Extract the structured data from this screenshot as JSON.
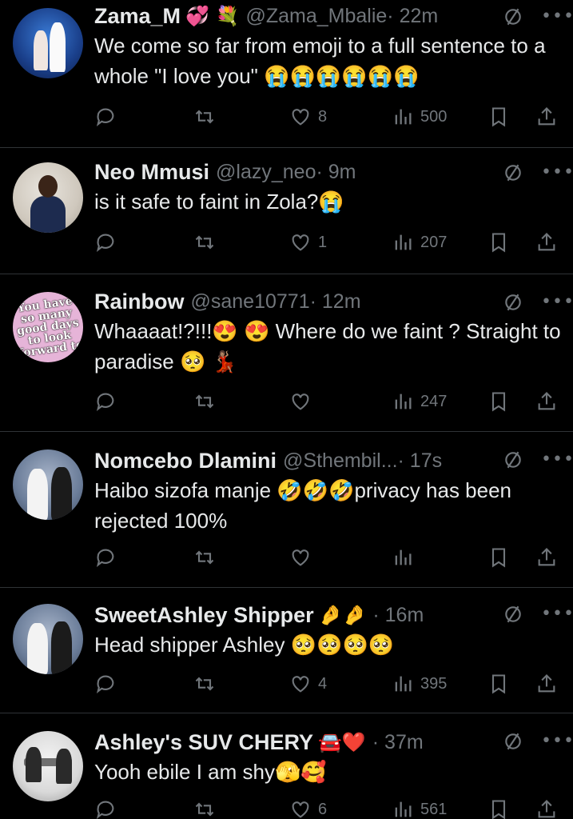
{
  "tweets": [
    {
      "name": "Zama_M",
      "name_emoji": "💞 💐",
      "handle": "@Zama_Mbalie",
      "time": "· 22m",
      "text": "We come so far from emoji to a full sentence to a whole \"I love you\" 😭😭😭😭😭😭",
      "likes": "8",
      "views": "500",
      "retweets": "",
      "replies": ""
    },
    {
      "name": "Neo Mmusi",
      "name_emoji": "",
      "handle": "@lazy_neo",
      "time": "· 9m",
      "text": "is it safe to faint in Zola?😭",
      "likes": "1",
      "views": "207",
      "retweets": "",
      "replies": ""
    },
    {
      "name": "Rainbow",
      "name_emoji": "",
      "handle": "@sane10771",
      "time": "· 12m",
      "text": "Whaaaat!?!!!😍 😍 Where do we faint ? Straight to paradise 🥺 💃🏽",
      "likes": "",
      "views": "247",
      "retweets": "",
      "replies": "",
      "avatar_text": [
        "You have",
        "so many",
        "good days",
        "to look",
        "forward to"
      ]
    },
    {
      "name": "Nomcebo Dlamini",
      "name_emoji": "",
      "handle": "@Sthembil...",
      "time": "· 17s",
      "text": "Haibo sizofa manje 🤣🤣🤣privacy has been rejected 100%",
      "likes": "",
      "views": "",
      "retweets": "",
      "replies": ""
    },
    {
      "name": "SweetAshley Shipper",
      "name_emoji": "🤌🤌",
      "handle": "",
      "time": "· 16m",
      "text": "Head shipper Ashley 🥺🥺🥺🥺",
      "likes": "4",
      "views": "395",
      "retweets": "",
      "replies": ""
    },
    {
      "name": "Ashley's SUV CHERY",
      "name_emoji": "🚘❤️",
      "handle": "",
      "time": "· 37m",
      "text": "Yooh ebile I am shy🫣🥰",
      "likes": "6",
      "views": "561",
      "retweets": "",
      "replies": ""
    }
  ],
  "icons": {
    "reply": "reply-icon",
    "retweet": "retweet-icon",
    "like": "heart-icon",
    "views": "views-icon",
    "bookmark": "bookmark-icon",
    "share": "share-icon",
    "grok": "grok-icon",
    "more": "more-icon"
  },
  "colors": {
    "background": "#000000",
    "text": "#e7e9ea",
    "secondary": "#71767b",
    "divider": "#2f3336"
  }
}
